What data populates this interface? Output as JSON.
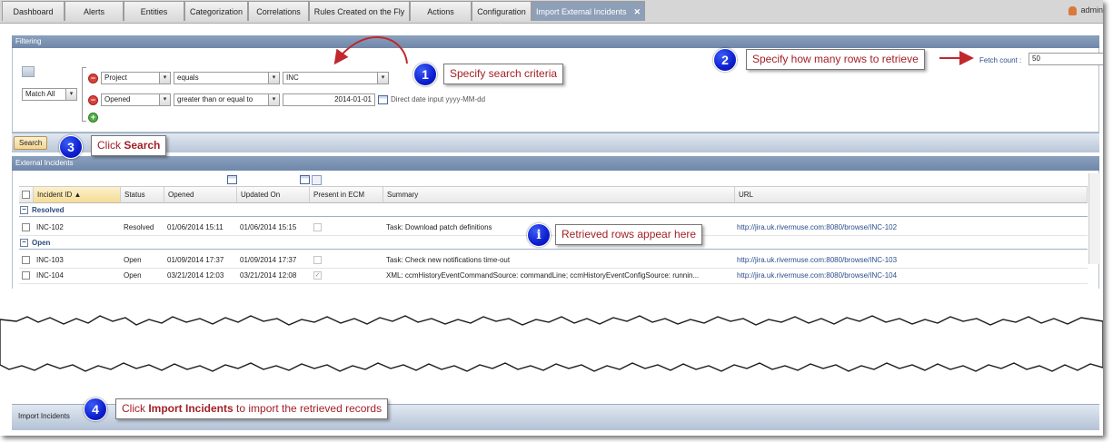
{
  "tabs": [
    {
      "label": "Dashboard",
      "active": false
    },
    {
      "label": "Alerts",
      "active": false
    },
    {
      "label": "Entities",
      "active": false
    },
    {
      "label": "Categorization",
      "active": false
    },
    {
      "label": "Correlations",
      "active": false
    },
    {
      "label": "Rules Created on the Fly",
      "active": false
    },
    {
      "label": "Actions",
      "active": false
    },
    {
      "label": "Configuration",
      "active": false
    },
    {
      "label": "Import External Incidents",
      "active": true
    }
  ],
  "user": {
    "name": "admin"
  },
  "filtering": {
    "title": "Filtering",
    "match_mode": "Match All",
    "criteria": [
      {
        "field": "Project",
        "operator": "equals",
        "value": "INC"
      },
      {
        "field": "Opened",
        "operator": "greater than or equal to",
        "value": "2014-01-01"
      }
    ],
    "date_hint": "Direct date input yyyy-MM-dd",
    "fetch_label": "Fetch count :",
    "fetch_value": "50",
    "search_label": "Search"
  },
  "incidents": {
    "title": "External Incidents",
    "columns": [
      "Incident ID",
      "Status",
      "Opened",
      "Updated On",
      "Present in ECM",
      "Summary",
      "URL"
    ],
    "groups": [
      {
        "name": "Resolved",
        "rows": [
          {
            "id": "INC-102",
            "status": "Resolved",
            "opened": "01/06/2014 15:11",
            "updated": "01/06/2014 15:15",
            "present": false,
            "summary": "Task: Download patch definitions",
            "url": "http://jira.uk.rivermuse.com:8080/browse/INC-102"
          }
        ]
      },
      {
        "name": "Open",
        "rows": [
          {
            "id": "INC-103",
            "status": "Open",
            "opened": "01/09/2014 17:37",
            "updated": "01/09/2014 17:37",
            "present": false,
            "summary": "Task: Check new notifications time-out",
            "url": "http://jira.uk.rivermuse.com:8080/browse/INC-103"
          },
          {
            "id": "INC-104",
            "status": "Open",
            "opened": "03/21/2014 12:03",
            "updated": "03/21/2014 12:08",
            "present": true,
            "summary": "XML: ccmHistoryEventCommandSource: commandLine; ccmHistoryEventConfigSource: runnin...",
            "url": "http://jira.uk.rivermuse.com:8080/browse/INC-104"
          }
        ]
      }
    ]
  },
  "import_bar": {
    "label": "Import Incidents"
  },
  "callouts": {
    "step1": {
      "num": "1",
      "text": "Specify search criteria"
    },
    "step2": {
      "num": "2",
      "text": "Specify how many rows to retrieve"
    },
    "step3": {
      "num": "3",
      "prefix": "Click ",
      "bold": "Search"
    },
    "info": {
      "num": "i",
      "text": "Retrieved rows appear here"
    },
    "step4": {
      "num": "4",
      "prefix": "Click ",
      "bold": "Import Incidents",
      "suffix": " to import the retrieved records"
    }
  },
  "colors": {
    "callout_text": "#a31f26",
    "badge": "#1029e0",
    "header": "#7a90b0",
    "link": "#2a4f8c"
  }
}
